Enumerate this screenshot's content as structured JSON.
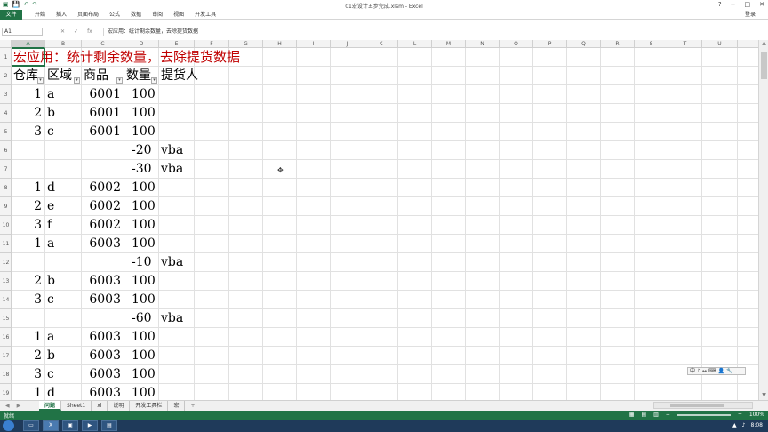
{
  "window": {
    "title": "01宏设计五步完成.xlsm - Excel",
    "help": "?",
    "min": "−",
    "max": "□",
    "close": "✕"
  },
  "ribbon": {
    "file": "文件",
    "tabs": [
      "开始",
      "插入",
      "页面布局",
      "公式",
      "数据",
      "审阅",
      "视图",
      "开发工具"
    ],
    "login": "登录"
  },
  "formula": {
    "namebox": "A1",
    "cancel": "✕",
    "enter": "✓",
    "fx": "fx",
    "content": "宏应用：统计剩余数量，去除提货数据"
  },
  "columns": [
    "A",
    "B",
    "C",
    "D",
    "E",
    "F",
    "G",
    "H",
    "I",
    "J",
    "K",
    "L",
    "M",
    "N",
    "O",
    "P",
    "Q",
    "R",
    "S",
    "T",
    "U"
  ],
  "rows": [
    "1",
    "2",
    "3",
    "4",
    "5",
    "6",
    "7",
    "8",
    "9",
    "10",
    "11",
    "12",
    "13",
    "14",
    "15",
    "16",
    "17",
    "18",
    "19"
  ],
  "title_cell": "宏应用：统计剩余数量，去除提货数据",
  "headers": [
    "仓库",
    "区域",
    "商品",
    "数量",
    "提货人"
  ],
  "data": [
    {
      "a": "1",
      "b": "a",
      "c": "6001",
      "d": "100",
      "e": ""
    },
    {
      "a": "2",
      "b": "b",
      "c": "6001",
      "d": "100",
      "e": ""
    },
    {
      "a": "3",
      "b": "c",
      "c": "6001",
      "d": "100",
      "e": ""
    },
    {
      "a": "",
      "b": "",
      "c": "",
      "d": "-20",
      "e": "vba"
    },
    {
      "a": "",
      "b": "",
      "c": "",
      "d": "-30",
      "e": "vba"
    },
    {
      "a": "1",
      "b": "d",
      "c": "6002",
      "d": "100",
      "e": ""
    },
    {
      "a": "2",
      "b": "e",
      "c": "6002",
      "d": "100",
      "e": ""
    },
    {
      "a": "3",
      "b": "f",
      "c": "6002",
      "d": "100",
      "e": ""
    },
    {
      "a": "1",
      "b": "a",
      "c": "6003",
      "d": "100",
      "e": ""
    },
    {
      "a": "",
      "b": "",
      "c": "",
      "d": "-10",
      "e": "vba"
    },
    {
      "a": "2",
      "b": "b",
      "c": "6003",
      "d": "100",
      "e": ""
    },
    {
      "a": "3",
      "b": "c",
      "c": "6003",
      "d": "100",
      "e": ""
    },
    {
      "a": "",
      "b": "",
      "c": "",
      "d": "-60",
      "e": "vba"
    },
    {
      "a": "1",
      "b": "a",
      "c": "6003",
      "d": "100",
      "e": ""
    },
    {
      "a": "2",
      "b": "b",
      "c": "6003",
      "d": "100",
      "e": ""
    },
    {
      "a": "3",
      "b": "c",
      "c": "6003",
      "d": "100",
      "e": ""
    },
    {
      "a": "1",
      "b": "d",
      "c": "6003",
      "d": "100",
      "e": ""
    }
  ],
  "sheets": [
    "问题",
    "Sheet1",
    "xl",
    "说明",
    "开发工具栏",
    "宏"
  ],
  "sheet_add": "+",
  "status": {
    "ready": "就绪",
    "zoom": "100%"
  },
  "ime": [
    "中",
    "♪",
    "↔",
    "⌨",
    "👤",
    "🔧"
  ],
  "taskbar": {
    "time": "8:08"
  },
  "accent": "#217346"
}
